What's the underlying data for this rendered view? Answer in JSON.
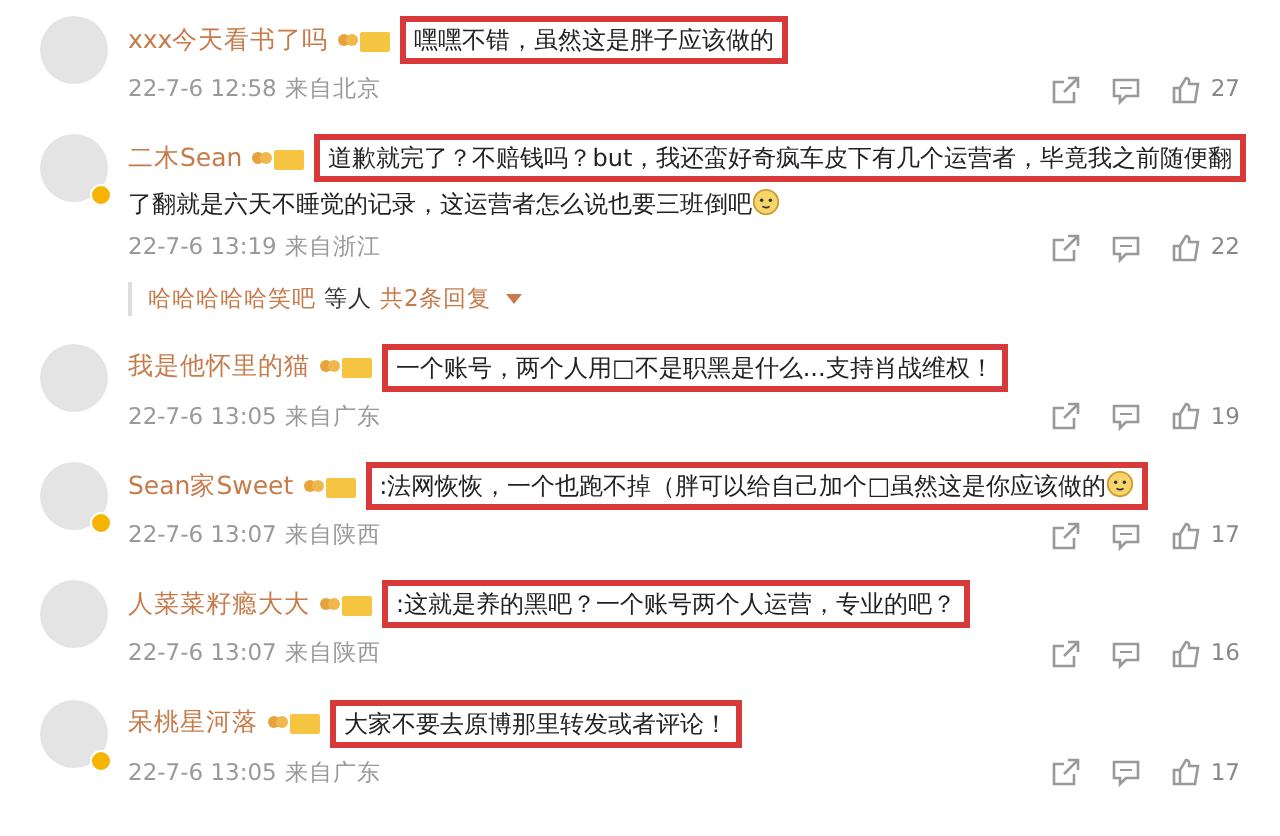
{
  "comments": [
    {
      "name": "xxx今天看书了吗",
      "text": "嘿嘿不错，虽然这是胖子应该做的",
      "emoji": false,
      "verified": false,
      "time": "22-7-6 12:58",
      "location": "来自北京",
      "likes": "27"
    },
    {
      "name": "二木Sean",
      "text": "道歉就完了？不赔钱吗？but，我还蛮好奇疯车皮下有几个运营者，毕竟我之前随便翻",
      "text_cont": "了翻就是六天不睡觉的记录，这运营者怎么说也要三班倒吧",
      "emoji": true,
      "verified": true,
      "time": "22-7-6 13:19",
      "location": "来自浙江",
      "likes": "22",
      "reply": {
        "user": "哈哈哈哈哈笑吧",
        "middle": "等人",
        "count": "共2条回复"
      }
    },
    {
      "name": "我是他怀里的猫",
      "text": "一个账号，两个人用□不是职黑是什么...支持肖战维权！",
      "emoji": false,
      "verified": false,
      "time": "22-7-6 13:05",
      "location": "来自广东",
      "likes": "19"
    },
    {
      "name": "Sean家Sweet",
      "text": ":法网恢恢，一个也跑不掉（胖可以给自己加个□虽然这是你应该做的",
      "emoji": true,
      "verified": true,
      "time": "22-7-6 13:07",
      "location": "来自陕西",
      "likes": "17"
    },
    {
      "name": "人菜菜籽瘾大大",
      "text": ":这就是养的黑吧？一个账号两个人运营，专业的吧？",
      "emoji": false,
      "verified": false,
      "time": "22-7-6 13:07",
      "location": "来自陕西",
      "likes": "16"
    },
    {
      "name": "呆桃星河落",
      "text": "大家不要去原博那里转发或者评论！",
      "emoji": false,
      "verified": true,
      "time": "22-7-6 13:05",
      "location": "来自广东",
      "likes": "17"
    }
  ]
}
